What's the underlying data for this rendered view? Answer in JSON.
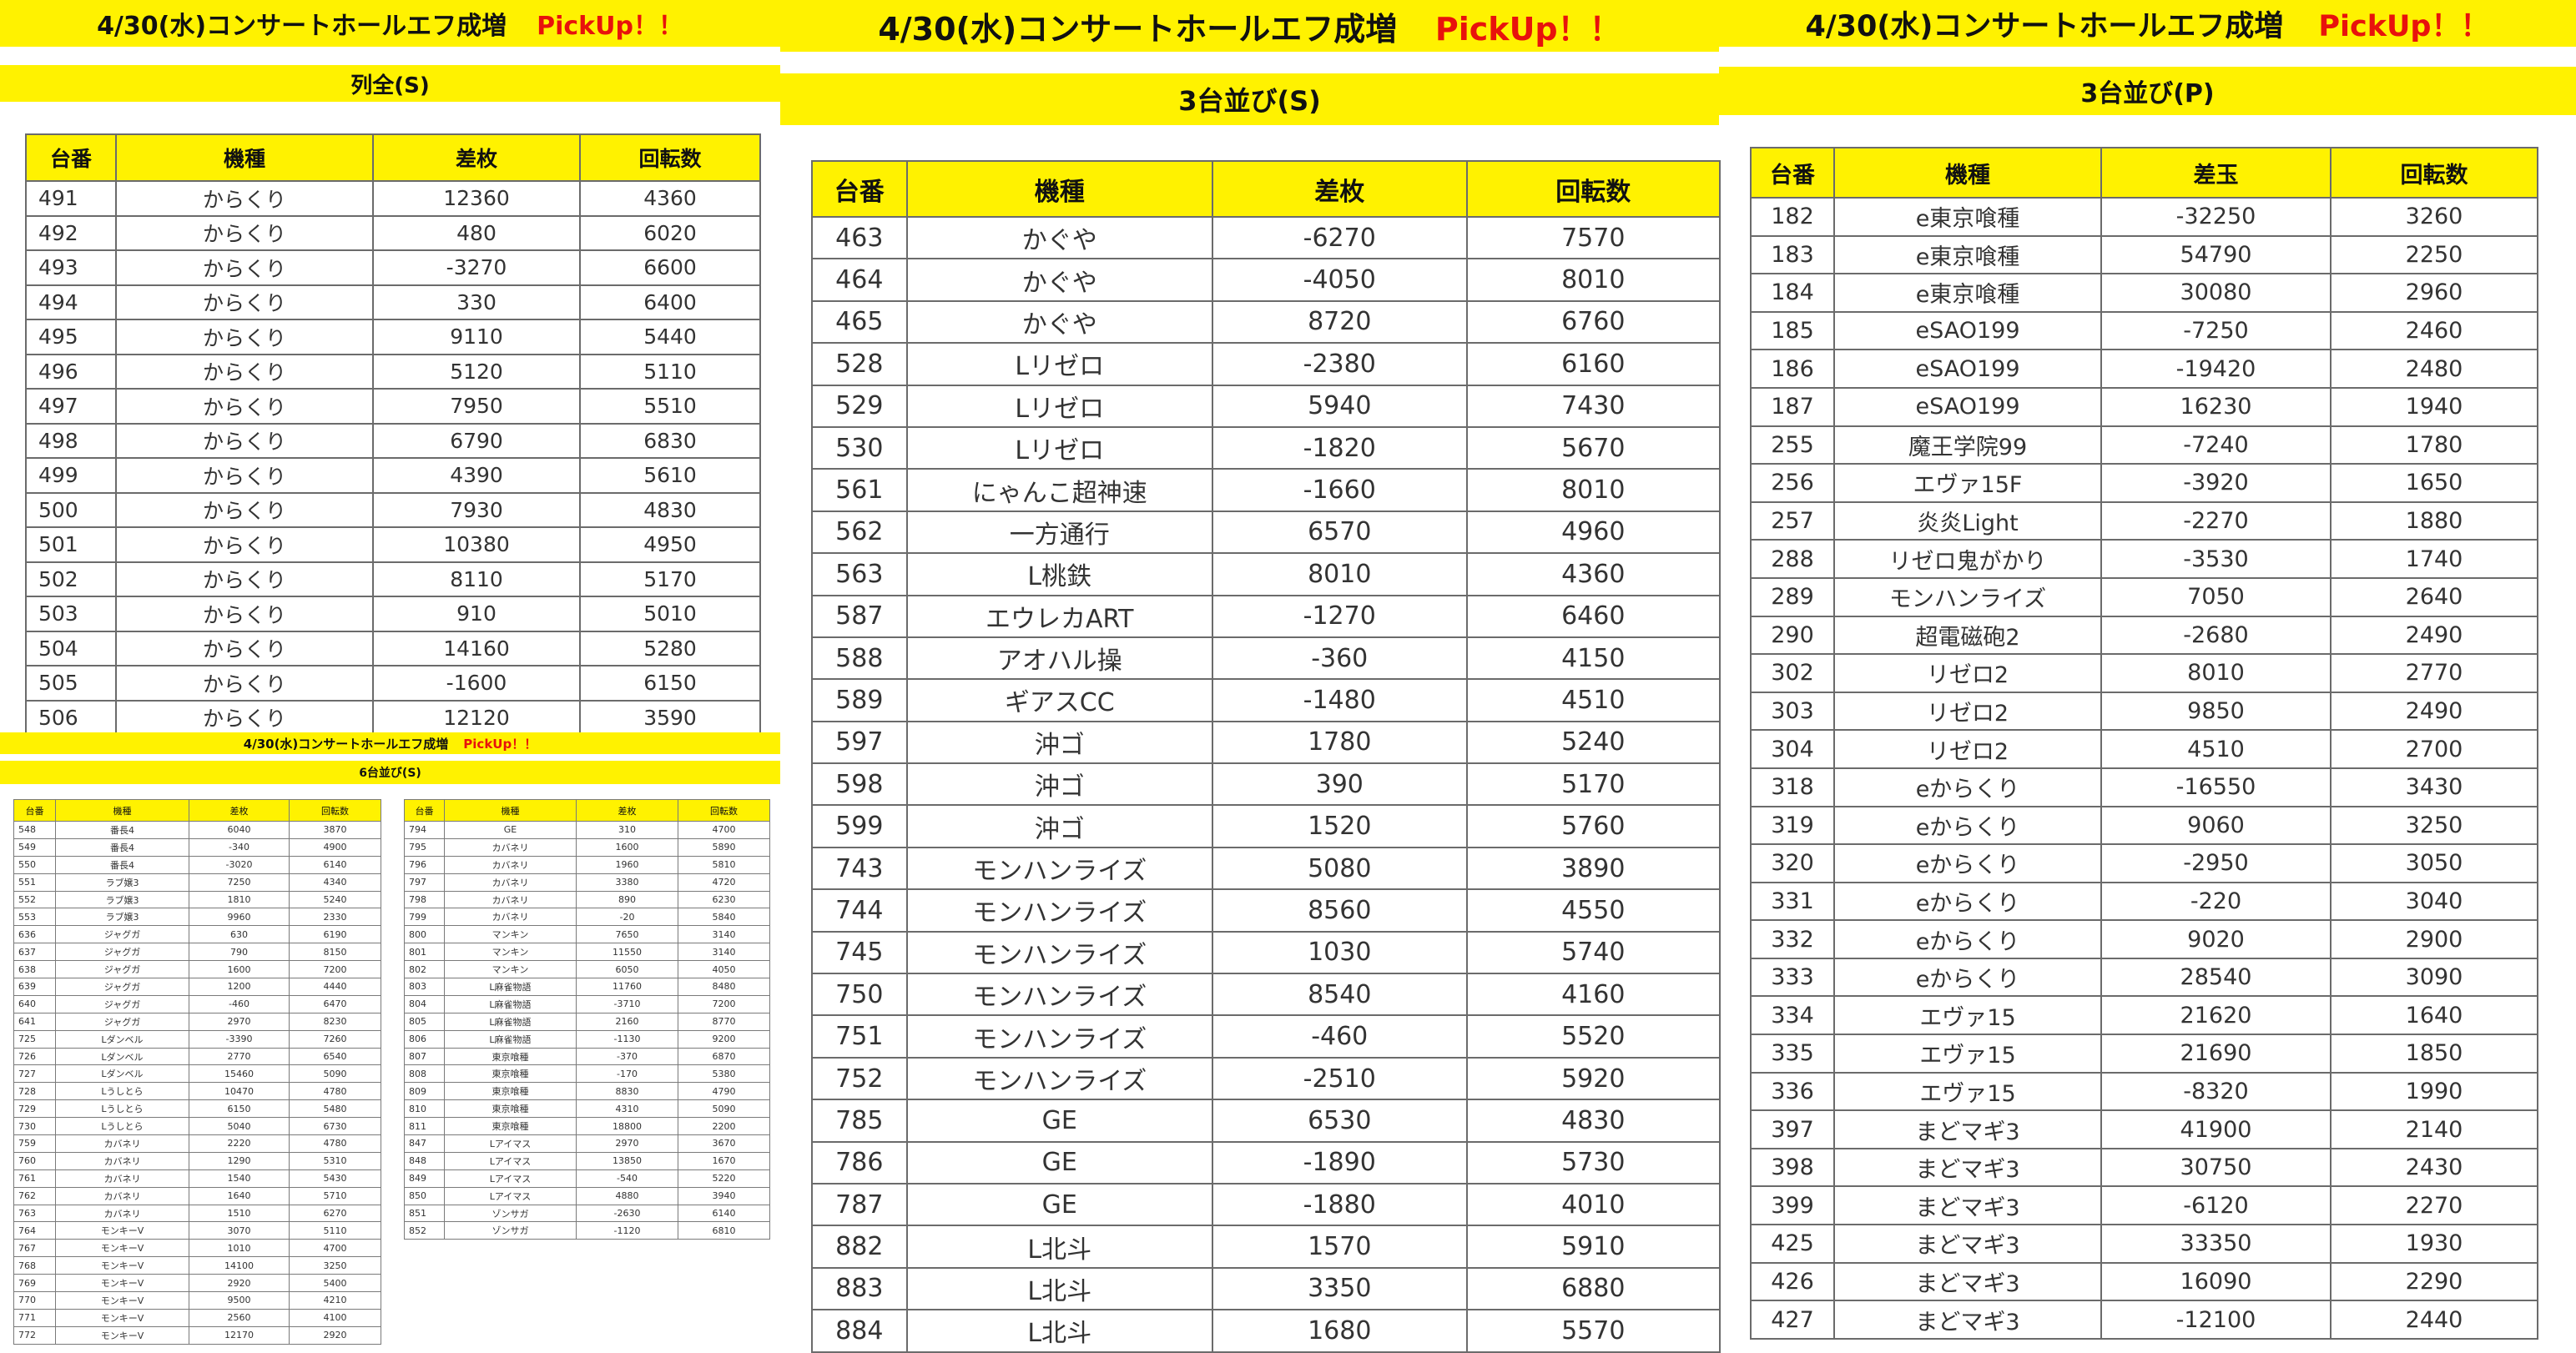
{
  "left": {
    "title": "4/30(水)コンサートホールエフ成増",
    "pickup": "PickUp！！",
    "subtitle": "列全(S)",
    "headers": [
      "台番",
      "機種",
      "差枚",
      "回転数"
    ],
    "rows": [
      [
        "491",
        "からくり",
        "12360",
        "4360"
      ],
      [
        "492",
        "からくり",
        "480",
        "6020"
      ],
      [
        "493",
        "からくり",
        "-3270",
        "6600"
      ],
      [
        "494",
        "からくり",
        "330",
        "6400"
      ],
      [
        "495",
        "からくり",
        "9110",
        "5440"
      ],
      [
        "496",
        "からくり",
        "5120",
        "5110"
      ],
      [
        "497",
        "からくり",
        "7950",
        "5510"
      ],
      [
        "498",
        "からくり",
        "6790",
        "6830"
      ],
      [
        "499",
        "からくり",
        "4390",
        "5610"
      ],
      [
        "500",
        "からくり",
        "7930",
        "4830"
      ],
      [
        "501",
        "からくり",
        "10380",
        "4950"
      ],
      [
        "502",
        "からくり",
        "8110",
        "5170"
      ],
      [
        "503",
        "からくり",
        "910",
        "5010"
      ],
      [
        "504",
        "からくり",
        "14160",
        "5280"
      ],
      [
        "505",
        "からくり",
        "-1600",
        "6150"
      ],
      [
        "506",
        "からくり",
        "12120",
        "3590"
      ]
    ]
  },
  "small": {
    "title": "4/30(水)コンサートホールエフ成増",
    "pickup": "PickUp！！",
    "subtitle": "6台並び(S)",
    "headers": [
      "台番",
      "機種",
      "差枚",
      "回転数"
    ],
    "rows_a": [
      [
        "548",
        "番長4",
        "6040",
        "3870"
      ],
      [
        "549",
        "番長4",
        "-340",
        "4900"
      ],
      [
        "550",
        "番長4",
        "-3020",
        "6140"
      ],
      [
        "551",
        "ラブ嬢3",
        "7250",
        "4340"
      ],
      [
        "552",
        "ラブ嬢3",
        "1810",
        "5240"
      ],
      [
        "553",
        "ラブ嬢3",
        "9960",
        "2330"
      ],
      [
        "636",
        "ジャグガ",
        "630",
        "6190"
      ],
      [
        "637",
        "ジャグガ",
        "790",
        "8150"
      ],
      [
        "638",
        "ジャグガ",
        "1600",
        "7200"
      ],
      [
        "639",
        "ジャグガ",
        "1200",
        "4440"
      ],
      [
        "640",
        "ジャグガ",
        "-460",
        "6470"
      ],
      [
        "641",
        "ジャグガ",
        "2970",
        "8230"
      ],
      [
        "725",
        "Lダンベル",
        "-3390",
        "7260"
      ],
      [
        "726",
        "Lダンベル",
        "2770",
        "6540"
      ],
      [
        "727",
        "Lダンベル",
        "15460",
        "5090"
      ],
      [
        "728",
        "Lうしとら",
        "10470",
        "4780"
      ],
      [
        "729",
        "Lうしとら",
        "6150",
        "5480"
      ],
      [
        "730",
        "Lうしとら",
        "5040",
        "6730"
      ],
      [
        "759",
        "カバネリ",
        "2220",
        "4780"
      ],
      [
        "760",
        "カバネリ",
        "1290",
        "5310"
      ],
      [
        "761",
        "カバネリ",
        "1540",
        "5430"
      ],
      [
        "762",
        "カバネリ",
        "1640",
        "5710"
      ],
      [
        "763",
        "カバネリ",
        "1510",
        "6270"
      ],
      [
        "764",
        "モンキーV",
        "3070",
        "5110"
      ],
      [
        "767",
        "モンキーV",
        "1010",
        "4700"
      ],
      [
        "768",
        "モンキーV",
        "14100",
        "3250"
      ],
      [
        "769",
        "モンキーV",
        "2920",
        "5400"
      ],
      [
        "770",
        "モンキーV",
        "9500",
        "4210"
      ],
      [
        "771",
        "モンキーV",
        "2560",
        "4100"
      ],
      [
        "772",
        "モンキーV",
        "12170",
        "2920"
      ]
    ],
    "rows_b": [
      [
        "794",
        "GE",
        "310",
        "4700"
      ],
      [
        "795",
        "カバネリ",
        "1600",
        "5890"
      ],
      [
        "796",
        "カバネリ",
        "1960",
        "5810"
      ],
      [
        "797",
        "カバネリ",
        "3380",
        "4720"
      ],
      [
        "798",
        "カバネリ",
        "890",
        "6230"
      ],
      [
        "799",
        "カバネリ",
        "-20",
        "5840"
      ],
      [
        "800",
        "マンキン",
        "7650",
        "3140"
      ],
      [
        "801",
        "マンキン",
        "11550",
        "3140"
      ],
      [
        "802",
        "マンキン",
        "6050",
        "4050"
      ],
      [
        "803",
        "L麻雀物語",
        "11760",
        "8480"
      ],
      [
        "804",
        "L麻雀物語",
        "-3710",
        "7200"
      ],
      [
        "805",
        "L麻雀物語",
        "2160",
        "8770"
      ],
      [
        "806",
        "L麻雀物語",
        "-1130",
        "9200"
      ],
      [
        "807",
        "東京喰種",
        "-370",
        "6870"
      ],
      [
        "808",
        "東京喰種",
        "-170",
        "5380"
      ],
      [
        "809",
        "東京喰種",
        "8830",
        "4790"
      ],
      [
        "810",
        "東京喰種",
        "4310",
        "5090"
      ],
      [
        "811",
        "東京喰種",
        "18800",
        "2200"
      ],
      [
        "847",
        "Lアイマス",
        "2970",
        "3670"
      ],
      [
        "848",
        "Lアイマス",
        "13850",
        "1670"
      ],
      [
        "849",
        "Lアイマス",
        "-540",
        "5220"
      ],
      [
        "850",
        "Lアイマス",
        "4880",
        "3940"
      ],
      [
        "851",
        "ゾンサガ",
        "-2630",
        "6140"
      ],
      [
        "852",
        "ゾンサガ",
        "-1120",
        "6810"
      ]
    ]
  },
  "middle": {
    "title": "4/30(水)コンサートホールエフ成増",
    "pickup": "PickUp！！",
    "subtitle": "3台並び(S)",
    "headers": [
      "台番",
      "機種",
      "差枚",
      "回転数"
    ],
    "rows": [
      [
        "463",
        "かぐや",
        "-6270",
        "7570"
      ],
      [
        "464",
        "かぐや",
        "-4050",
        "8010"
      ],
      [
        "465",
        "かぐや",
        "8720",
        "6760"
      ],
      [
        "528",
        "Lリゼロ",
        "-2380",
        "6160"
      ],
      [
        "529",
        "Lリゼロ",
        "5940",
        "7430"
      ],
      [
        "530",
        "Lリゼロ",
        "-1820",
        "5670"
      ],
      [
        "561",
        "にゃんこ超神速",
        "-1660",
        "8010"
      ],
      [
        "562",
        "一方通行",
        "6570",
        "4960"
      ],
      [
        "563",
        "L桃鉄",
        "8010",
        "4360"
      ],
      [
        "587",
        "エウレカART",
        "-1270",
        "6460"
      ],
      [
        "588",
        "アオハル操",
        "-360",
        "4150"
      ],
      [
        "589",
        "ギアスCC",
        "-1480",
        "4510"
      ],
      [
        "597",
        "沖ゴ",
        "1780",
        "5240"
      ],
      [
        "598",
        "沖ゴ",
        "390",
        "5170"
      ],
      [
        "599",
        "沖ゴ",
        "1520",
        "5760"
      ],
      [
        "743",
        "モンハンライズ",
        "5080",
        "3890"
      ],
      [
        "744",
        "モンハンライズ",
        "8560",
        "4550"
      ],
      [
        "745",
        "モンハンライズ",
        "1030",
        "5740"
      ],
      [
        "750",
        "モンハンライズ",
        "8540",
        "4160"
      ],
      [
        "751",
        "モンハンライズ",
        "-460",
        "5520"
      ],
      [
        "752",
        "モンハンライズ",
        "-2510",
        "5920"
      ],
      [
        "785",
        "GE",
        "6530",
        "4830"
      ],
      [
        "786",
        "GE",
        "-1890",
        "5730"
      ],
      [
        "787",
        "GE",
        "-1880",
        "4010"
      ],
      [
        "882",
        "L北斗",
        "1570",
        "5910"
      ],
      [
        "883",
        "L北斗",
        "3350",
        "6880"
      ],
      [
        "884",
        "L北斗",
        "1680",
        "5570"
      ]
    ]
  },
  "right": {
    "title": "4/30(水)コンサートホールエフ成増",
    "pickup": "PickUp！！",
    "subtitle": "3台並び(P)",
    "headers": [
      "台番",
      "機種",
      "差玉",
      "回転数"
    ],
    "rows": [
      [
        "182",
        "e東京喰種",
        "-32250",
        "3260"
      ],
      [
        "183",
        "e東京喰種",
        "54790",
        "2250"
      ],
      [
        "184",
        "e東京喰種",
        "30080",
        "2960"
      ],
      [
        "185",
        "eSAO199",
        "-7250",
        "2460"
      ],
      [
        "186",
        "eSAO199",
        "-19420",
        "2480"
      ],
      [
        "187",
        "eSAO199",
        "16230",
        "1940"
      ],
      [
        "255",
        "魔王学院99",
        "-7240",
        "1780"
      ],
      [
        "256",
        "エヴァ15F",
        "-3920",
        "1650"
      ],
      [
        "257",
        "炎炎Light",
        "-2270",
        "1880"
      ],
      [
        "288",
        "リゼロ鬼がかり",
        "-3530",
        "1740"
      ],
      [
        "289",
        "モンハンライズ",
        "7050",
        "2640"
      ],
      [
        "290",
        "超電磁砲2",
        "-2680",
        "2490"
      ],
      [
        "302",
        "リゼロ2",
        "8010",
        "2770"
      ],
      [
        "303",
        "リゼロ2",
        "9850",
        "2490"
      ],
      [
        "304",
        "リゼロ2",
        "4510",
        "2700"
      ],
      [
        "318",
        "eからくり",
        "-16550",
        "3430"
      ],
      [
        "319",
        "eからくり",
        "9060",
        "3250"
      ],
      [
        "320",
        "eからくり",
        "-2950",
        "3050"
      ],
      [
        "331",
        "eからくり",
        "-220",
        "3040"
      ],
      [
        "332",
        "eからくり",
        "9020",
        "2900"
      ],
      [
        "333",
        "eからくり",
        "28540",
        "3090"
      ],
      [
        "334",
        "エヴァ15",
        "21620",
        "1640"
      ],
      [
        "335",
        "エヴァ15",
        "21690",
        "1850"
      ],
      [
        "336",
        "エヴァ15",
        "-8320",
        "1990"
      ],
      [
        "397",
        "まどマギ3",
        "41900",
        "2140"
      ],
      [
        "398",
        "まどマギ3",
        "30750",
        "2430"
      ],
      [
        "399",
        "まどマギ3",
        "-6120",
        "2270"
      ],
      [
        "425",
        "まどマギ3",
        "33350",
        "1930"
      ],
      [
        "426",
        "まどマギ3",
        "16090",
        "2290"
      ],
      [
        "427",
        "まどマギ3",
        "-12100",
        "2440"
      ]
    ]
  },
  "colors": {
    "highlight": "#fff200",
    "pickup": "#e8120c",
    "border": "#6b6b6b"
  }
}
